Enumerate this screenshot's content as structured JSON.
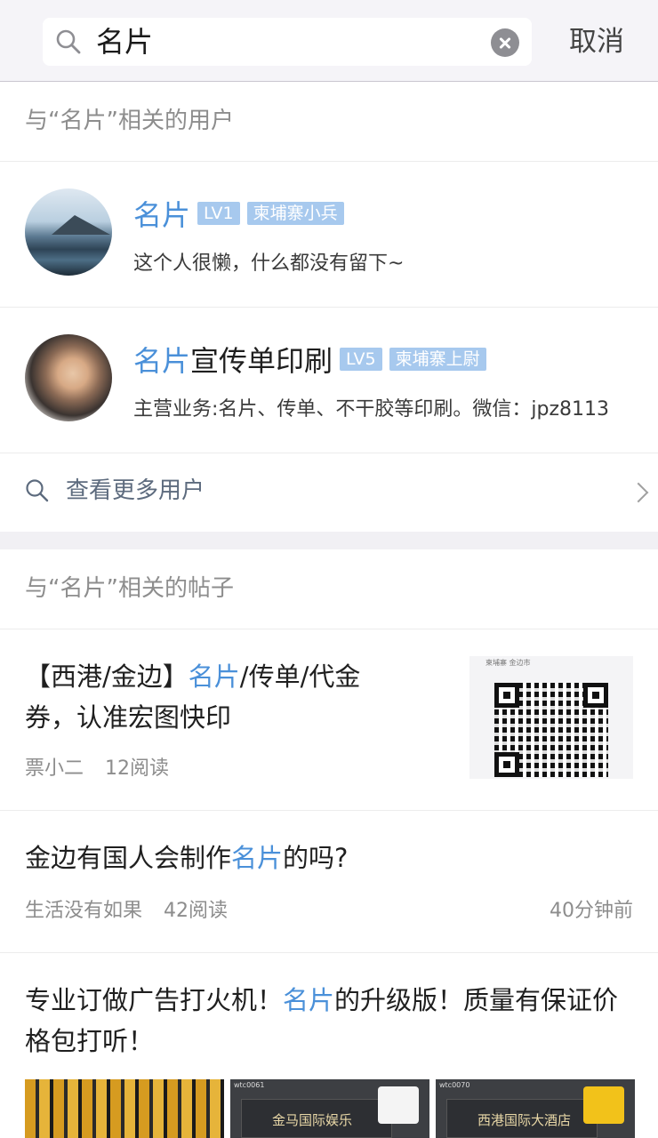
{
  "search": {
    "query": "名片",
    "cancel_label": "取消"
  },
  "users_section": {
    "heading": "与“名片”相关的用户",
    "users": [
      {
        "name_highlight": "名片",
        "name_rest": "",
        "level": "LV1",
        "rank": "柬埔寨小兵",
        "bio": "这个人很懒，什么都没有留下~"
      },
      {
        "name_highlight": "名片",
        "name_rest": "宣传单印刷",
        "level": "LV5",
        "rank": "柬埔寨上尉",
        "bio": "主营业务:名片、传单、不干胶等印刷。微信：jpz8113"
      }
    ],
    "more_label": "查看更多用户"
  },
  "posts_section": {
    "heading": "与“名片”相关的帖子",
    "posts": [
      {
        "title_before": "【西港/金边】",
        "title_highlight": "名片",
        "title_after": "/传单/代金券，认准宏图快印",
        "author": "票小二",
        "reads": "12阅读",
        "thumb_header": "柬埔寨 金边市"
      },
      {
        "title_before": "金边有国人会制作",
        "title_highlight": "名片",
        "title_after": "的吗?",
        "author": "生活没有如果",
        "reads": "42阅读",
        "time": "40分钟前"
      },
      {
        "title_before": "专业订做广告打火机！",
        "title_highlight": "名片",
        "title_after": "的升级版！质量有保证价格包打听！",
        "images": [
          {
            "tag": ""
          },
          {
            "tag": "wtc0061",
            "text": "金马国际娱乐"
          },
          {
            "tag": "wtc0070",
            "text": "西港国际大酒店"
          }
        ]
      }
    ]
  },
  "colors": {
    "highlight": "#4a90d9",
    "badge_bg": "#a7c9ee",
    "meta_gray": "#8d8d8d"
  }
}
